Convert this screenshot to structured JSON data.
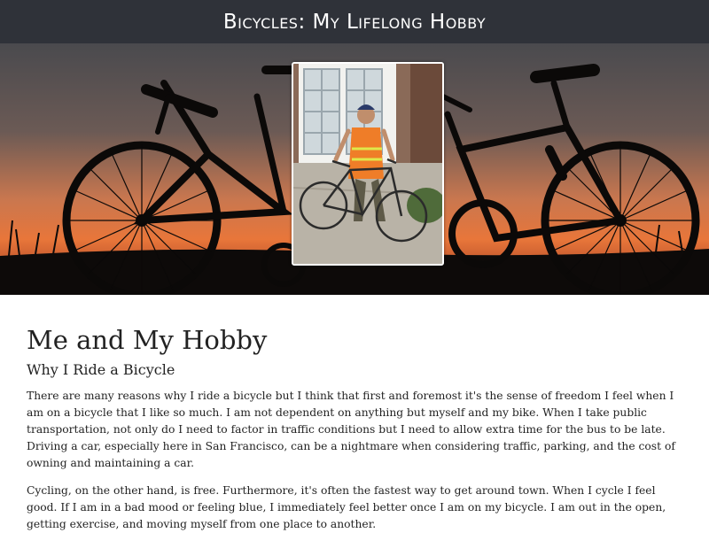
{
  "header": {
    "title": "Bicycles: My Lifelong Hobby"
  },
  "hero": {
    "background_description": "silhouette of bicycles against sunset",
    "photo_description": "man in safety vest holding a bicycle"
  },
  "colors": {
    "header_bg": "#2f3239",
    "sunset_orange": "#e8763a",
    "text": "#222222"
  },
  "main": {
    "title": "Me and My Hobby",
    "subtitle": "Why I Ride a Bicycle",
    "paragraphs": [
      "There are many reasons why I ride a bicycle but I think that first and foremost it's the sense of freedom I feel when I am on a bicycle that I like so much. I am not dependent on anything but myself and my bike. When I take public transportation, not only do I need to factor in traffic conditions but I need to allow extra time for the bus to be late. Driving a car, especially here in San Francisco, can be a nightmare when considering traffic, parking, and the cost of owning and maintaining a car.",
      "Cycling, on the other hand, is free. Furthermore, it's often the fastest way to get around town. When I cycle I feel good. If I am in a bad mood or feeling blue, I immediately feel better once I am on my bicycle. I am out in the open, getting exercise, and moving myself from one place to another."
    ]
  }
}
